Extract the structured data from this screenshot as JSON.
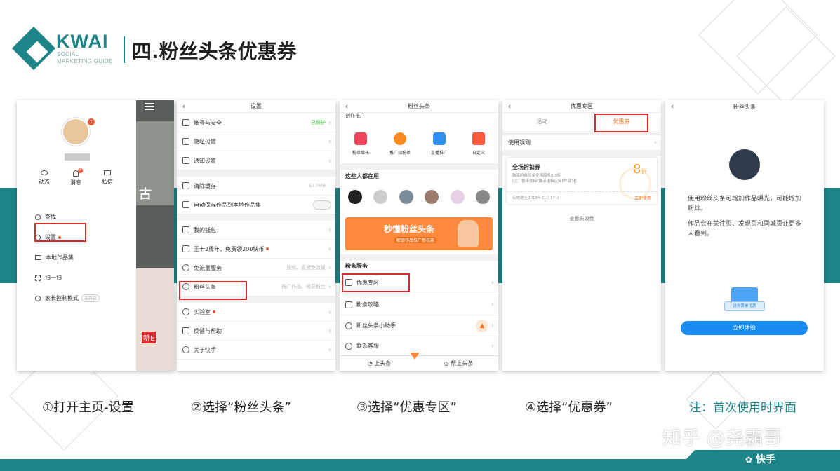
{
  "header": {
    "logo_text": "KWAI",
    "logo_sub1": "SOCIAL",
    "logo_sub2": "MARKETING GUIDE",
    "title": "四.粉丝头条优惠券"
  },
  "colors": {
    "accent": "#1d8487",
    "highlight_box": "#d62c2c",
    "brand_orange": "#ff6f1a",
    "link_blue": "#1a8cf0"
  },
  "steps": [
    {
      "caption": "①打开主页-设置"
    },
    {
      "caption": "②选择“粉丝头条”"
    },
    {
      "caption": "③选择“优惠专区”"
    },
    {
      "caption": "④选择“优惠券”"
    },
    {
      "caption": "注：首次使用时界面"
    }
  ],
  "phone1": {
    "badge": "1",
    "avatar_icon": "cat-avatar-icon",
    "icons": [
      {
        "label": "动态",
        "icon": "eye-icon"
      },
      {
        "label": "消息",
        "icon": "bell-icon",
        "badge": "4"
      },
      {
        "label": "私信",
        "icon": "mail-icon"
      }
    ],
    "menu": [
      {
        "label": "查找",
        "icon": "search-icon"
      },
      {
        "label": "设置",
        "icon": "gear-icon"
      },
      {
        "label": "本地作品集",
        "icon": "folder-icon"
      },
      {
        "label": "扫一扫",
        "icon": "scan-icon"
      },
      {
        "label": "家长控制模式",
        "icon": "shield-icon",
        "tag": "未开启"
      }
    ],
    "bg_text1": "古",
    "bg_text2": "听E"
  },
  "phone2": {
    "title": "设置",
    "rows": [
      {
        "label": "帐号与安全",
        "hint": "已保护"
      },
      {
        "label": "隐私设置",
        "hint": ""
      },
      {
        "label": "通知设置",
        "hint": ""
      },
      {
        "label": "清除缓存",
        "hint": "637MB"
      },
      {
        "label": "自动保存作品到本地作品集",
        "hint": ""
      },
      {
        "label": "我的钱包",
        "hint": ""
      },
      {
        "label": "王卡2周年，免费领200快币",
        "hint": ""
      },
      {
        "label": "免流量服务",
        "hint": "视频、直播免流量"
      },
      {
        "label": "粉丝头条",
        "hint": "推广作品、吸获粉丝"
      },
      {
        "label": "实验室",
        "hint": ""
      },
      {
        "label": "反馈与帮助",
        "hint": ""
      },
      {
        "label": "关于快手",
        "hint": ""
      }
    ]
  },
  "phone3": {
    "title": "粉丝头条",
    "top_label": "创作推广",
    "features": [
      {
        "label": "粉丝增长",
        "color": "#f0445a"
      },
      {
        "label": "推广招粉丝",
        "color": "#ff8a1f"
      },
      {
        "label": "直播推广",
        "color": "#2e8ff0"
      },
      {
        "label": "自定义",
        "color": "#ff5a3c"
      }
    ],
    "users_title": "这些人都在用",
    "banner_text": "秒懂粉丝头条",
    "banner_sub": "解锁作品推广新技能",
    "service_title": "粉条服务",
    "services": [
      {
        "label": "优惠专区"
      },
      {
        "label": "粉条攻略"
      },
      {
        "label": "粉丝头条小助手"
      },
      {
        "label": "联系客服"
      }
    ],
    "bottom_left": "上头条",
    "bottom_right": "帮上头条"
  },
  "phone4": {
    "title": "优惠专区",
    "tabs": [
      "活动",
      "优惠券"
    ],
    "rules": "使用规则",
    "coupon_title": "全场折扣券",
    "coupon_line1": "购买粉丝头条全场服务8.0折",
    "coupon_line2": "(注：暂不支持\"展示给特定用户\"部分)",
    "discount_num": "8",
    "discount_unit": "折",
    "valid": "有效期至2018年11月17日",
    "use_now": "立即使用",
    "view_expired": "查看失效券"
  },
  "phone5": {
    "title": "粉丝头条",
    "para1": "使用粉丝头条可增加作品曝光，可能增加粉丝。",
    "para2": "作品会在关注页、发现页和同城页让更多人看到。",
    "gift_label": "送你首单优惠",
    "button": "立即体验"
  },
  "watermark": "知乎 @尧霸哥",
  "brand": "快手"
}
